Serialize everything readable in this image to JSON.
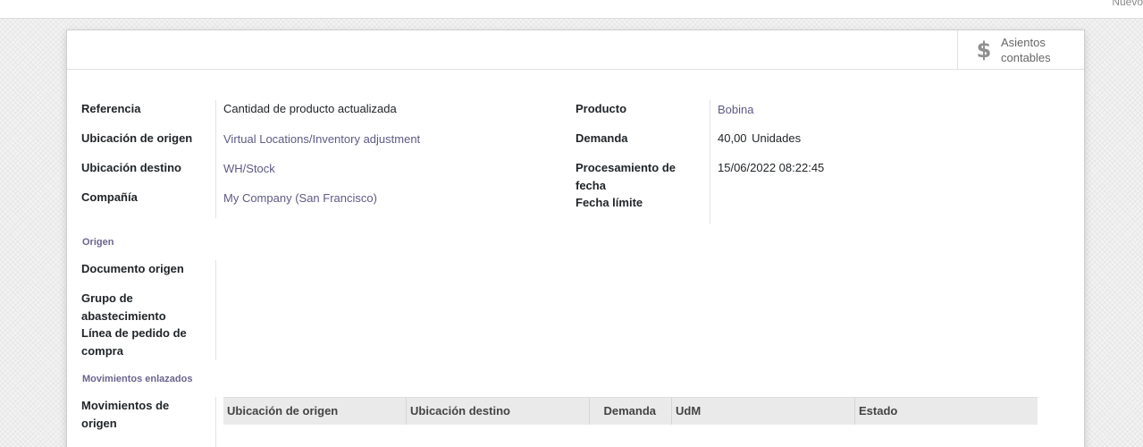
{
  "topbar": {
    "new_button_label": "Nuevo"
  },
  "buttons": {
    "journal_entries_label": "Asientos contables",
    "journal_entries_icon": "dollar-icon"
  },
  "fields": {
    "reference": {
      "label": "Referencia",
      "value": "Cantidad de producto actualizada"
    },
    "source_location": {
      "label": "Ubicación de origen",
      "value": "Virtual Locations/Inventory adjustment"
    },
    "dest_location": {
      "label": "Ubicación destino",
      "value": "WH/Stock"
    },
    "company": {
      "label": "Compañía",
      "value": "My Company (San Francisco)"
    },
    "product": {
      "label": "Producto",
      "value": "Bobina"
    },
    "demand": {
      "label": "Demanda",
      "value": "40,00",
      "uom": "Unidades"
    },
    "date_processing": {
      "label": "Procesamiento de fecha",
      "value": "15/06/2022 08:22:45"
    },
    "deadline": {
      "label": "Fecha límite",
      "value": ""
    }
  },
  "origin_section": {
    "title": "Origen",
    "source_document_label": "Documento origen",
    "procurement_group_label": "Grupo de abastecimiento",
    "purchase_line_label": "Línea de pedido de compra"
  },
  "linked_section": {
    "title": "Movimientos enlazados",
    "origin_moves_label": "Movimientos de origen",
    "columns": [
      "Ubicación de origen",
      "Ubicación destino",
      "Demanda",
      "UdM",
      "Estado"
    ]
  }
}
